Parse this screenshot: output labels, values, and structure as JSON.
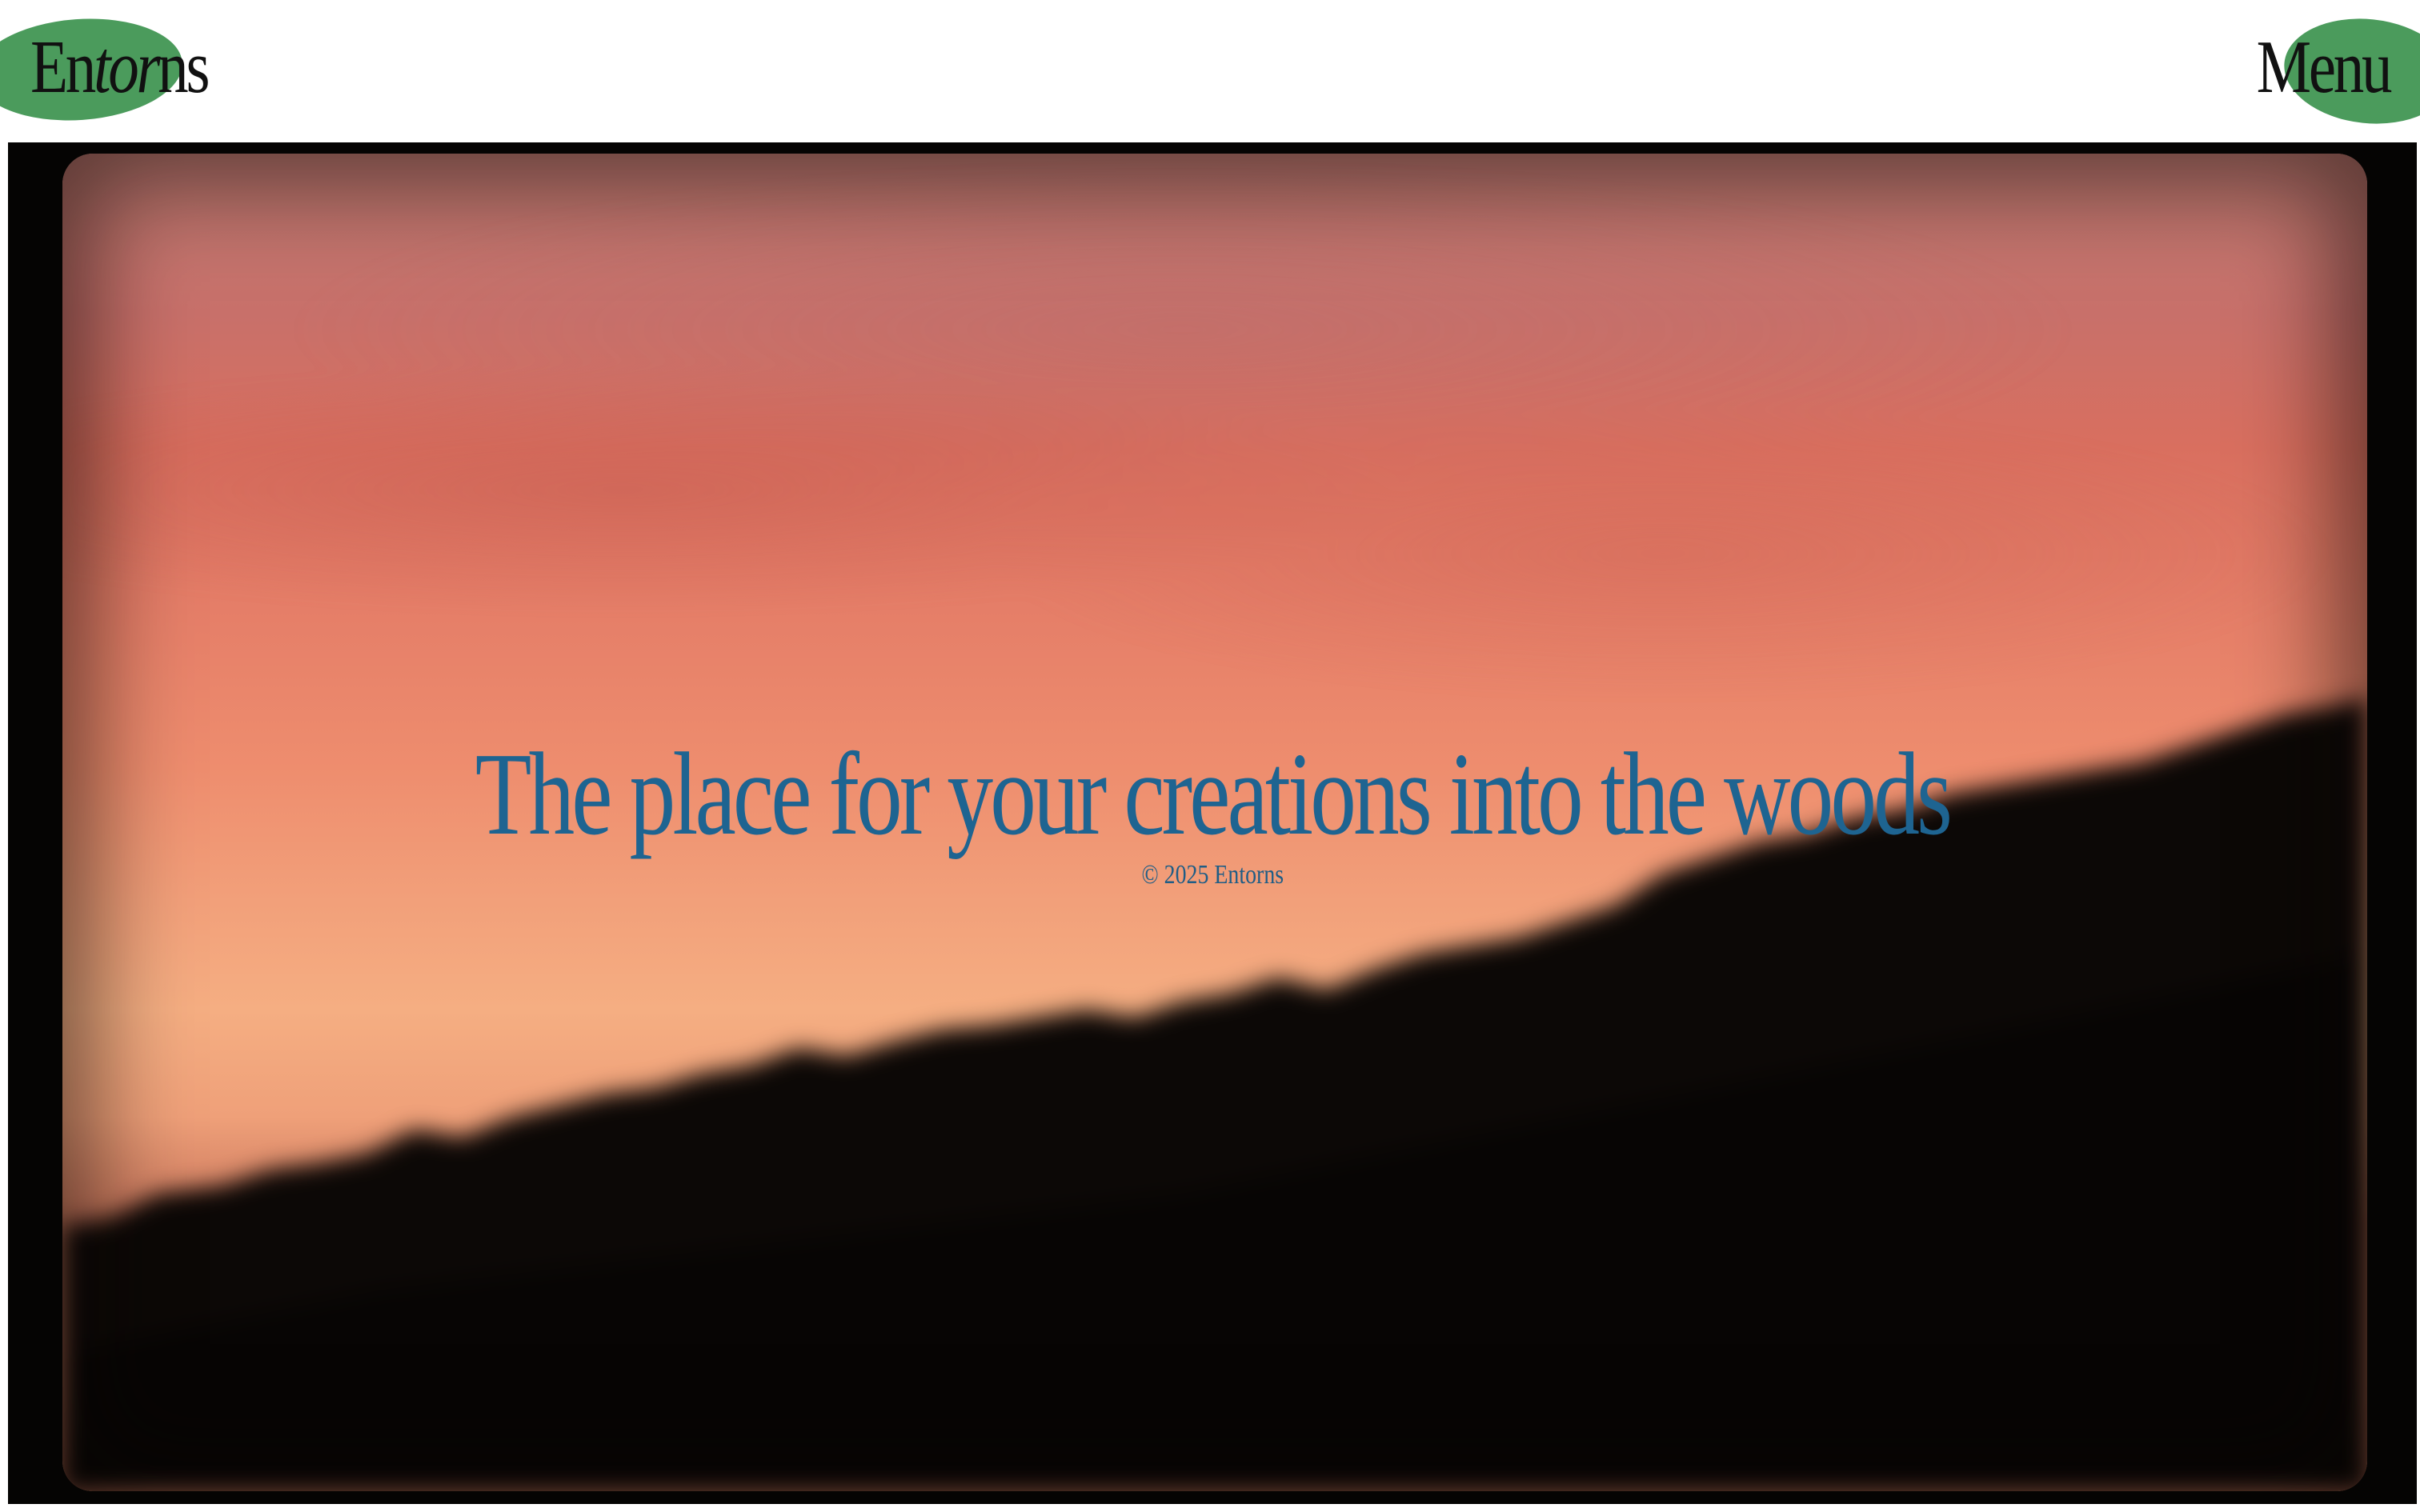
{
  "header": {
    "logo": {
      "part1": "En",
      "part2_italic": "tor",
      "part3": "ns"
    },
    "menu_label": "Menu"
  },
  "hero": {
    "headline": "The place for your creations into the woods",
    "copyright": "© 2025 Entorns"
  },
  "colors": {
    "accent_green": "#4b9b5c",
    "headline_blue": "#1e6491",
    "frame_black": "#050403",
    "sky_top": "#c27b73",
    "sky_mid": "#e57e68",
    "sky_glow": "#f5ae82"
  }
}
